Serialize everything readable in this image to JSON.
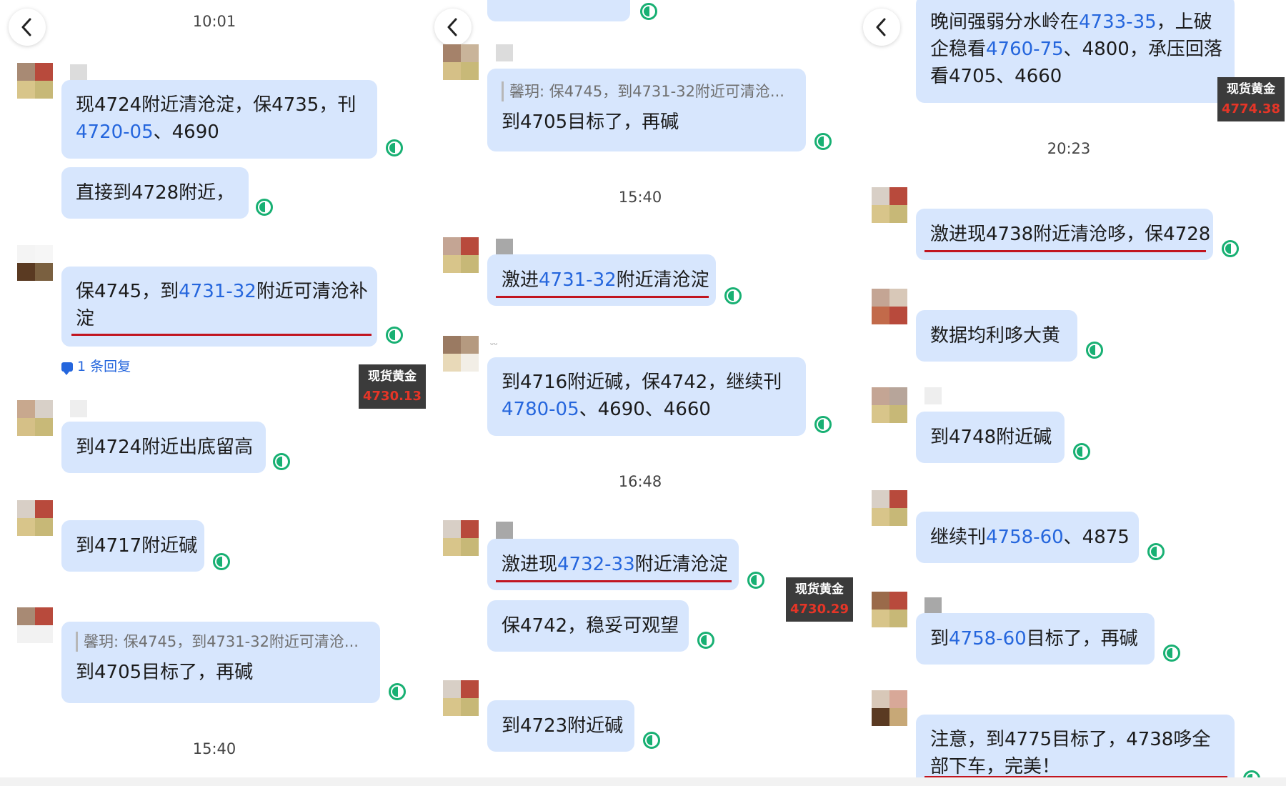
{
  "gold_label": "现货黄金",
  "panel1": {
    "time_top": "10:01",
    "msg1": {
      "a": "现4724附近清沧淀，保4735，刊",
      "b_blue": "4720-05",
      "b_rest": "、4690"
    },
    "msg2": "直接到4728附近，",
    "msg3": {
      "a_pre": "保4745，到",
      "a_blue": "4731-32",
      "a_post": "附近可清沧补",
      "b": "淀"
    },
    "reply_count": "1 条回复",
    "gold_price": "4730.13",
    "msg4": "到4724附近出底留高",
    "msg5": "到4717附近碱",
    "msg6": {
      "quote": "馨玥: 保4745，到4731-32附近可清沧...",
      "text": "到4705目标了，再碱"
    },
    "time_bottom": "15:40"
  },
  "panel2": {
    "msg1": {
      "quote": "馨玥: 保4745，到4731-32附近可清沧...",
      "text": "到4705目标了，再碱"
    },
    "time1": "15:40",
    "msg2": {
      "pre": "激进",
      "blue": "4731-32",
      "post": "附近清沧淀"
    },
    "sender_partial": "ᵕᵕ",
    "msg3": {
      "a": "到4716附近碱，保4742，继续刊",
      "b_blue": "4780-05",
      "b_rest": "、4690、4660"
    },
    "time2": "16:48",
    "msg4": {
      "pre": "激进现",
      "blue": "4732-33",
      "post": "附近清沧淀"
    },
    "gold_price": "4730.29",
    "msg5": "保4742，稳妥可观望",
    "msg6": "到4723附近碱"
  },
  "panel3": {
    "msg1": {
      "a_pre": "晚间强弱分水岭在",
      "a_blue": "4733-35",
      "a_post": "，上破",
      "b_pre": "企稳看",
      "b_blue": "4760-75",
      "b_post": "、4800，承压回落",
      "c": "看4705、4660"
    },
    "gold_price": "4774.38",
    "time1": "20:23",
    "msg2": "激进现4738附近清沧哆，保4728",
    "msg3": "数据均利哆大黄",
    "msg4": "到4748附近碱",
    "msg5": {
      "pre": "继续刊",
      "blue": "4758-60",
      "post": "、4875"
    },
    "msg6": {
      "pre": "到",
      "blue": "4758-60",
      "post": "目标了，再碱"
    },
    "msg7": {
      "a": "注意，到4775目标了，4738哆全",
      "b": "部下车，完美！"
    }
  },
  "colors": {
    "bubble": "#d7e6fd",
    "link_blue": "#2566dd",
    "underline_red": "#c11520",
    "status_green": "#18b073",
    "price_red": "#e53527"
  }
}
